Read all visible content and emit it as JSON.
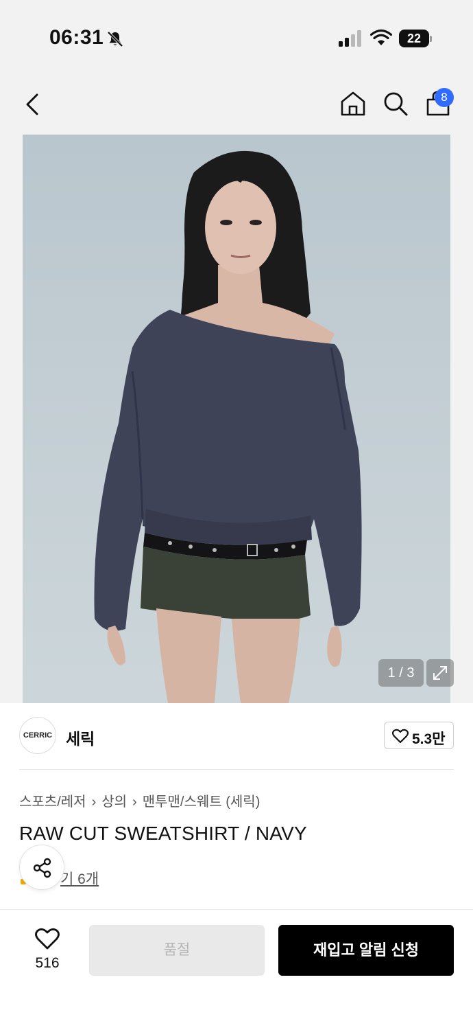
{
  "status_bar": {
    "time": "06:31",
    "battery": "22",
    "icons": [
      "bell-muted-icon",
      "signal-icon",
      "wifi-icon",
      "battery-icon"
    ]
  },
  "nav": {
    "icons": [
      "back-icon",
      "home-icon",
      "search-icon",
      "cart-icon"
    ],
    "cart_count": "8"
  },
  "gallery": {
    "counter": "1 / 3",
    "icons": [
      "expand-icon"
    ]
  },
  "brand": {
    "logo_text": "CERRIC",
    "name": "세릭",
    "likes": "5.3만"
  },
  "breadcrumb": [
    "스포츠/레저",
    "상의",
    "맨투맨/스웨트 (세릭)"
  ],
  "product": {
    "title": "RAW CUT SWEATSHIRT / NAVY",
    "review_text": "기 6개"
  },
  "bottom": {
    "wish_count": "516",
    "soldout_label": "품절",
    "restock_label": "재입고 알림 신청"
  },
  "colors": {
    "accent": "#2f6bff",
    "primary_button": "#000000",
    "disabled_button": "#e9e9e9"
  }
}
